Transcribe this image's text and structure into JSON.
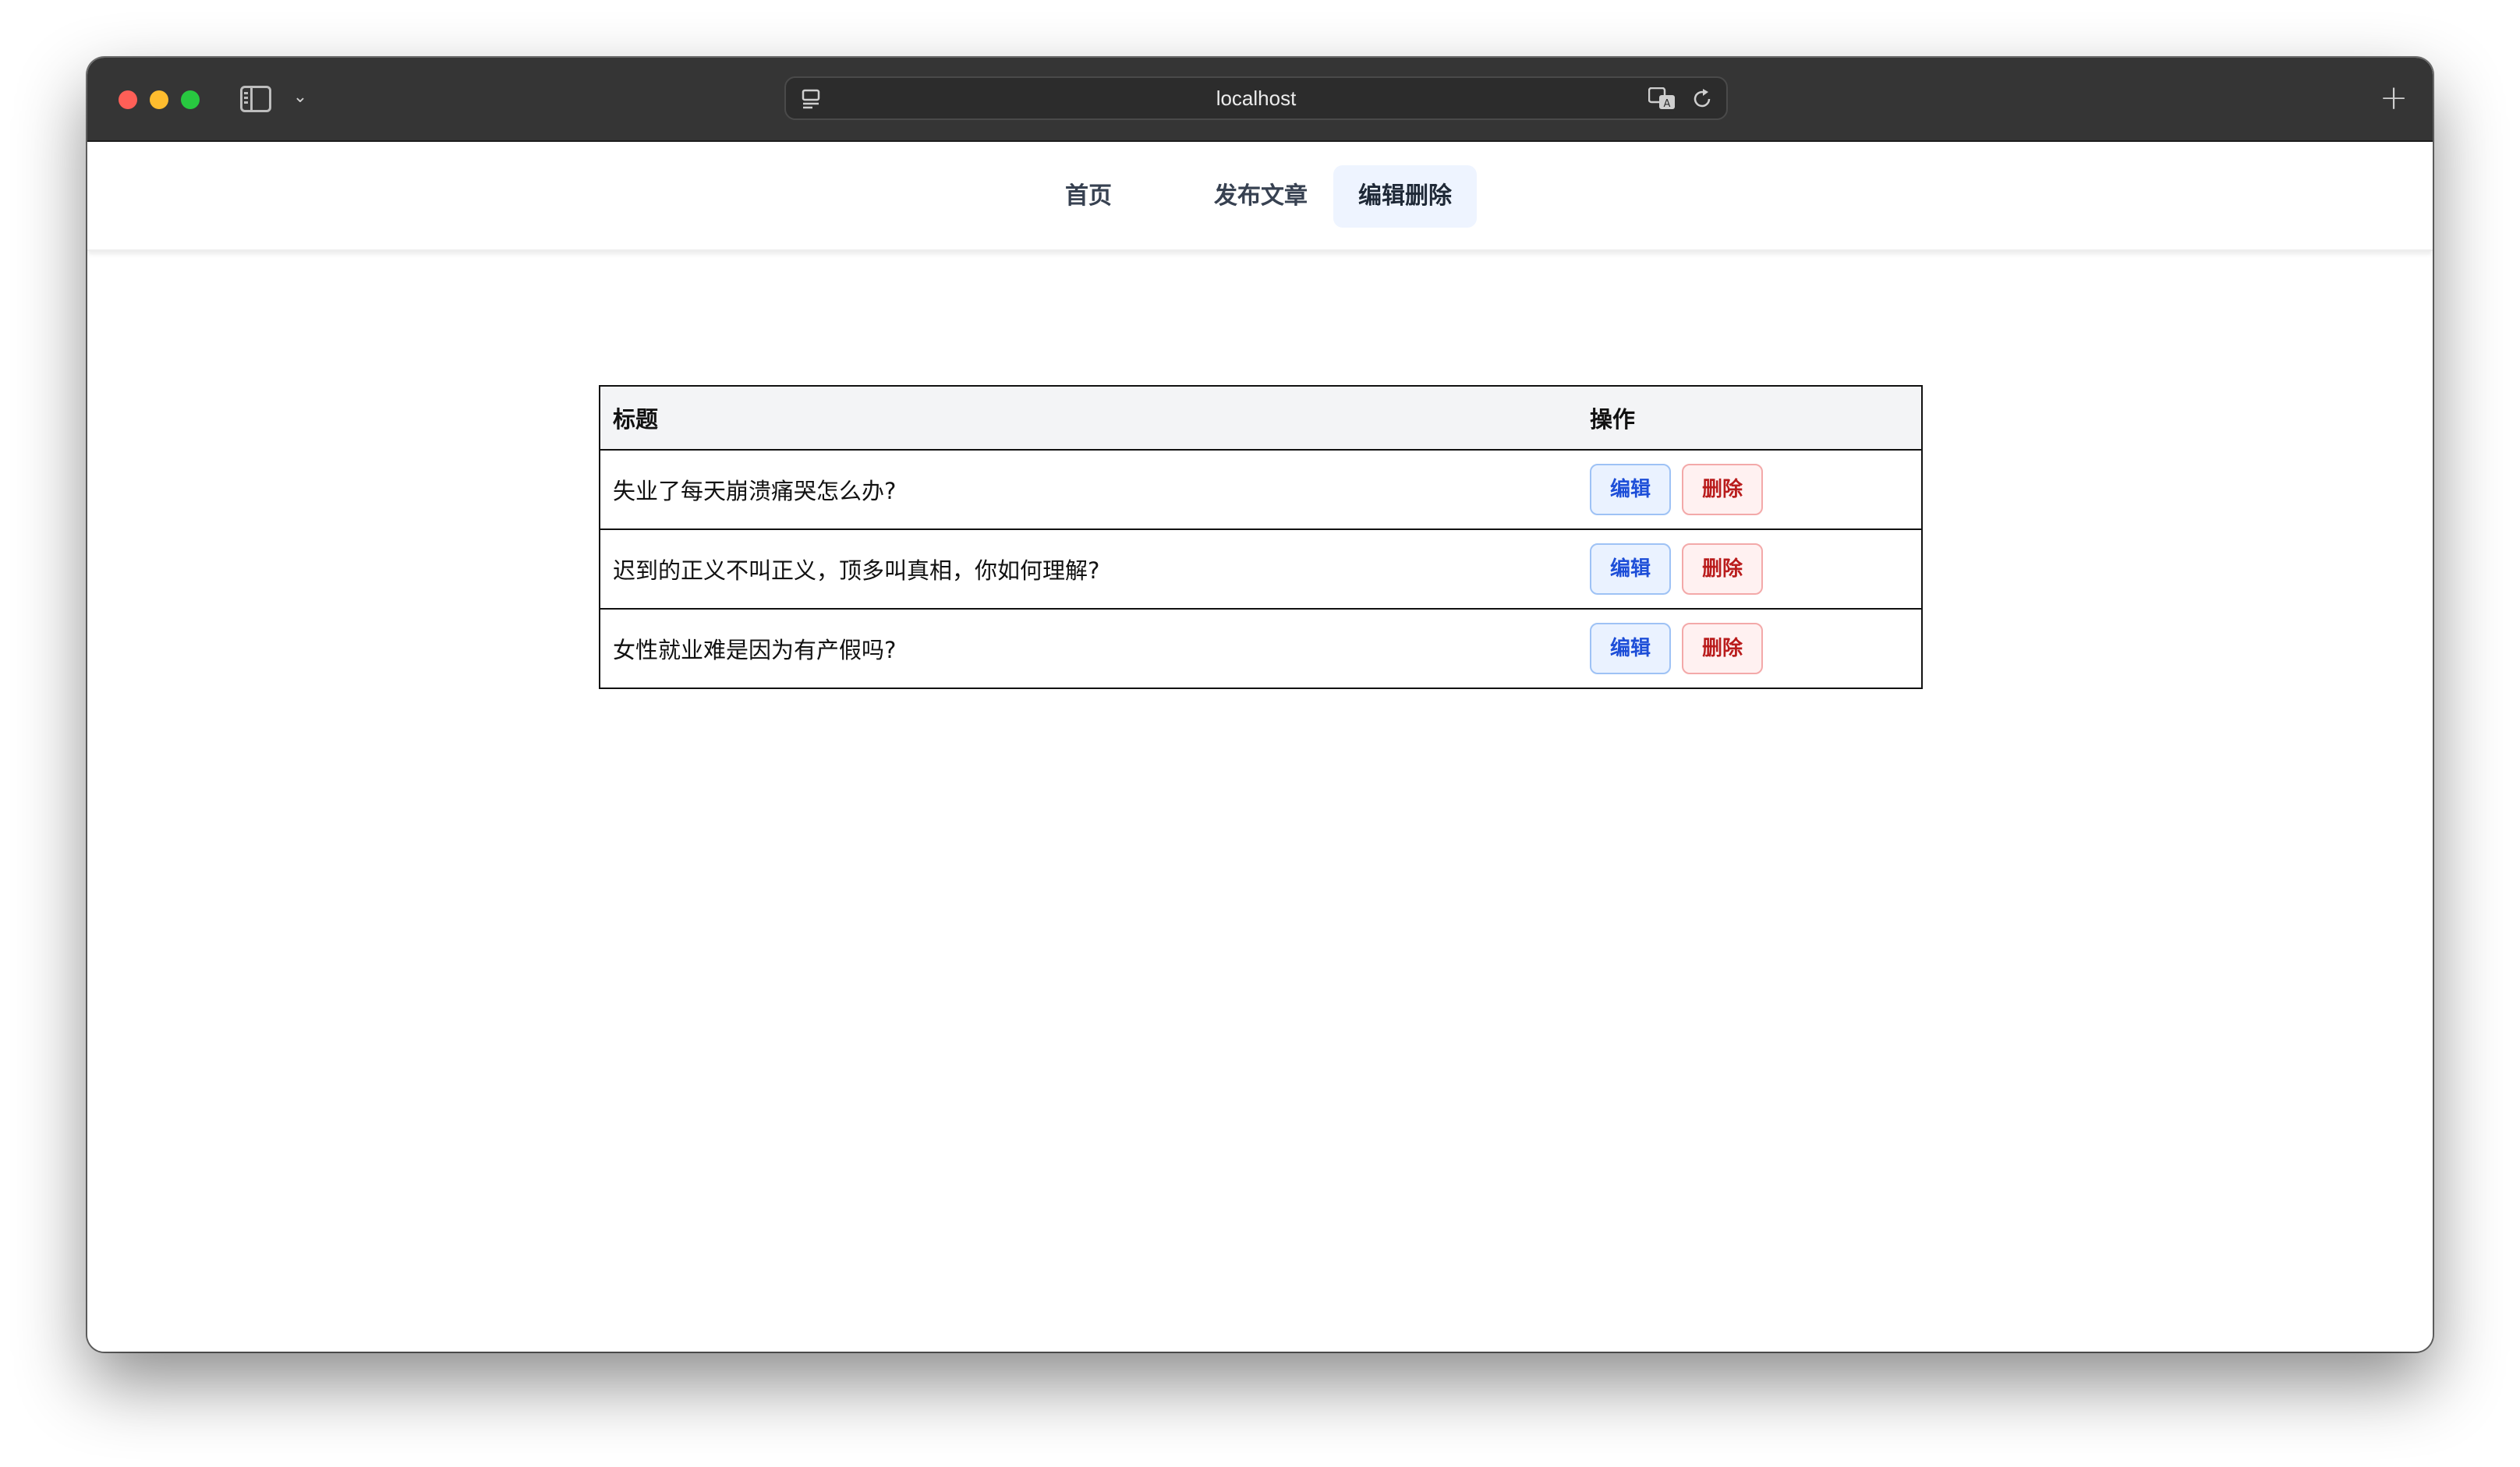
{
  "browser": {
    "url": "localhost",
    "new_tab_symbol": "+"
  },
  "navbar": {
    "items": [
      {
        "label": "首页",
        "active": false
      },
      {
        "label": "发布文章",
        "active": false
      },
      {
        "label": "编辑删除",
        "active": true
      }
    ],
    "active_color": "#eef4ff"
  },
  "table": {
    "headers": {
      "title": "标题",
      "actions": "操作"
    },
    "rows": [
      {
        "title": "失业了每天崩溃痛哭怎么办?",
        "edit_label": "编辑",
        "delete_label": "删除"
      },
      {
        "title": "迟到的正义不叫正义，顶多叫真相，你如何理解?",
        "edit_label": "编辑",
        "delete_label": "删除"
      },
      {
        "title": "女性就业难是因为有产假吗?",
        "edit_label": "编辑",
        "delete_label": "删除"
      }
    ]
  },
  "colors": {
    "edit_button": "#1d4ed8",
    "delete_button": "#b91c1c",
    "titlebar": "#353535"
  },
  "icons": [
    "sidebar-icon",
    "chevron-down-icon",
    "site-logo-icon",
    "page-icon",
    "translate-icon",
    "reload-icon",
    "plus-icon"
  ]
}
